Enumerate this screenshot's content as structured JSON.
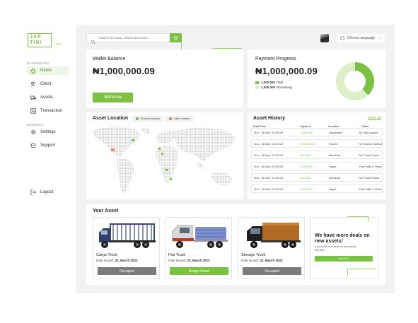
{
  "app": {
    "logo_line1": "JAP",
    "logo_line2": "TINI",
    "logo_sub": "asset"
  },
  "sidebar": {
    "section_dashboard": "DASHBOARD",
    "section_general": "GENERAL",
    "items": [
      {
        "label": "Home",
        "icon": "home-icon",
        "active": true
      },
      {
        "label": "Client",
        "icon": "user-icon"
      },
      {
        "label": "Assets",
        "icon": "truck-icon"
      },
      {
        "label": "Transaction",
        "icon": "transaction-icon"
      }
    ],
    "general_items": [
      {
        "label": "Settings",
        "icon": "gear-icon"
      },
      {
        "label": "Support",
        "icon": "chat-icon"
      }
    ],
    "logout_label": "Logout"
  },
  "topbar": {
    "search_placeholder": "Search for loans, assets and more...",
    "language_label": "Choose language"
  },
  "wallet": {
    "title": "Wallet Balance",
    "amount": "₦1,000,000.09",
    "withdraw_label": "Withdraw"
  },
  "payment": {
    "title": "Payment Progress",
    "amount": "₦1,000,000.09",
    "paid_amount": "1,000,000",
    "paid_label": "Paid",
    "remaining_amount": "1,000,000",
    "remaining_label": "Remaining",
    "paid_fraction": 0.38,
    "colors": {
      "paid": "#7cc242",
      "remaining": "#dcefc7"
    }
  },
  "asset_location": {
    "title": "Asset Location",
    "legend_present": "Present location",
    "legend_last": "Last Location",
    "colors": {
      "present": "#7cc242",
      "last": "#f08a5d"
    }
  },
  "asset_history": {
    "title": "Asset History",
    "view_all": "View all",
    "columns": [
      "Date/Time",
      "Payment",
      "Location",
      "Client"
    ],
    "rows": [
      {
        "date": "Sun - 14 April, 04:25 AM",
        "payment": "2,500,000",
        "location": "Nassarawa",
        "client": "Mr Seyi Lawson"
      },
      {
        "date": "Sun - 14 April, 04:25 AM",
        "payment": "40,000,000",
        "location": "Sokoto",
        "client": "Mr Ibrahim Damisa"
      },
      {
        "date": "Sun - 14 April, 04:25 AM",
        "payment": "800,000",
        "location": "Abeokuta",
        "client": "Mrs Tude Feyisa"
      },
      {
        "date": "Sun - 14 April, 04:25 AM",
        "payment": "1,000,000",
        "location": "Lagos",
        "client": "Flour Mills & Plaza"
      },
      {
        "date": "Sun - 14 April, 04:25 AM",
        "payment": "800,000",
        "location": "Abeokuta",
        "client": "Mrs Tude Feyisa"
      },
      {
        "date": "Sun - 14 April, 04:25 AM",
        "payment": "1,000,000",
        "location": "Lagos",
        "client": "Flour Mills & Plaza"
      }
    ]
  },
  "your_asset": {
    "title": "Your Asset",
    "assets": [
      {
        "name": "Cargo Truck",
        "date_label": "Date Issued:",
        "date": "22, March 2022",
        "status": "Occupied",
        "status_type": "occupied"
      },
      {
        "name": "Flat Truck",
        "date_label": "Date Issued:",
        "date": "22, March 2022",
        "status": "Assign Asset",
        "status_type": "assign"
      },
      {
        "name": "Storage Truck",
        "date_label": "Date Issued:",
        "date": "22, March 2022",
        "status": "Occupied",
        "status_type": "occupied"
      }
    ],
    "promo_title": "We have more deals on new assets!",
    "promo_text": "If you want more deals on new assets buy here",
    "promo_button": "Buy more"
  }
}
